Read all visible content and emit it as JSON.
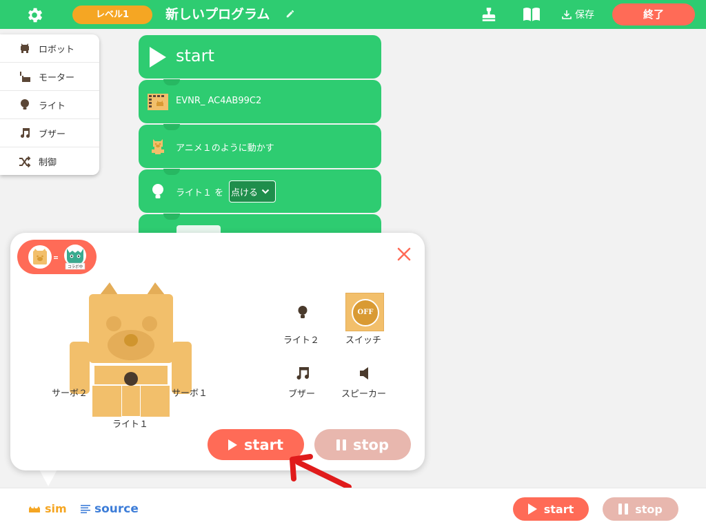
{
  "header": {
    "level_label": "レベル1",
    "program_title": "新しいプログラム",
    "save_label": "保存",
    "exit_label": "終了"
  },
  "palette": {
    "items": [
      {
        "label": "ロボット",
        "icon": "robot-icon"
      },
      {
        "label": "モーター",
        "icon": "motor-icon"
      },
      {
        "label": "ライト",
        "icon": "bulb-icon"
      },
      {
        "label": "ブザー",
        "icon": "music-note-icon"
      },
      {
        "label": "制御",
        "icon": "shuffle-icon"
      }
    ]
  },
  "blocks": {
    "start_label": "start",
    "robot_label": "EVNR_ AC4AB99C2",
    "anim_label": "アニメ１のように動かす",
    "light_label": "ライト１ を",
    "light_option": "点ける"
  },
  "sim": {
    "collab_badge": "コラボ中",
    "servo2": "サーボ２",
    "servo1": "サーボ１",
    "light1": "ライト１",
    "light2": "ライト２",
    "switch_label": "スイッチ",
    "switch_state": "OFF",
    "buzzer": "ブザー",
    "speaker": "スピーカー",
    "start": "start",
    "stop": "stop"
  },
  "bottom": {
    "sim_tab": "sim",
    "source_tab": "source",
    "start": "start",
    "stop": "stop"
  },
  "colors": {
    "header_green": "#2ecc71",
    "block_green": "#2ecc71",
    "level_orange": "#f5a623",
    "accent_red": "#ff6b57",
    "stop_disabled": "#e8b7ae",
    "robot_tan": "#f2bf6b",
    "source_blue": "#3d7dd8"
  }
}
